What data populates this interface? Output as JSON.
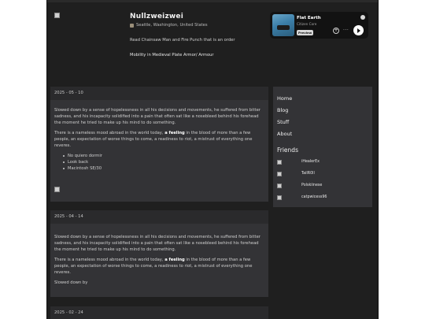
{
  "profile": {
    "name": "Nullzweizwei",
    "location": "Seattle, Washington, United States",
    "bio_line1": "Read Chainsaw Man and Fire Punch that is an order",
    "bio_line2": "Mobility in Medieval Plate Armor/ Armour"
  },
  "now_playing": {
    "track": "Flat Earth",
    "artist": "Citizen Core",
    "preview_label": "Preview",
    "add_glyph": "+",
    "more_glyph": "···"
  },
  "posts": [
    {
      "date": "2025 - 05 - 10",
      "para1": "Slowed down by a sense of hopelessness in all his decisions and movements, he suffered from bitter sadness, and his incapacity solidified into a pain that often sat like a nosebleed behind his forehead the moment he tried to make up his mind to do something.",
      "para2_before": "There is a nameless mood abroad in the world today, ",
      "para2_link": "a feeling",
      "para2_after": " in the blood of more than a few people, an expectation of worse things to come, a readiness to riot, a mistrust of everything one reveres.",
      "list": [
        "No quiero dormir",
        "Look back",
        "Macintosh SE/30"
      ]
    },
    {
      "date": "2025 - 04 - 14",
      "para1": "Slowed down by a sense of hopelessness in all his decisions and movements, he suffered from bitter sadness, and his incapacity solidified into a pain that often sat like a nosebleed behind his forehead the moment he tried to make up his mind to do something.",
      "para2_before": "There is a nameless mood abroad in the world today, ",
      "para2_link": "a feeling",
      "para2_after": " in the blood of more than a few people, an expectation of worse things to come, a readiness to riot, a mistrust of everything one reveres.",
      "para3": "Slowed down by"
    },
    {
      "date": "2025 - 02 - 24"
    }
  ],
  "sidebar": {
    "nav": [
      "Home",
      "Blog",
      "Stuff",
      "About"
    ],
    "friends_title": "Friends",
    "friends": [
      "iHealerEx",
      "TailR0ll",
      "Polskiinese",
      "catpwicess96"
    ]
  }
}
